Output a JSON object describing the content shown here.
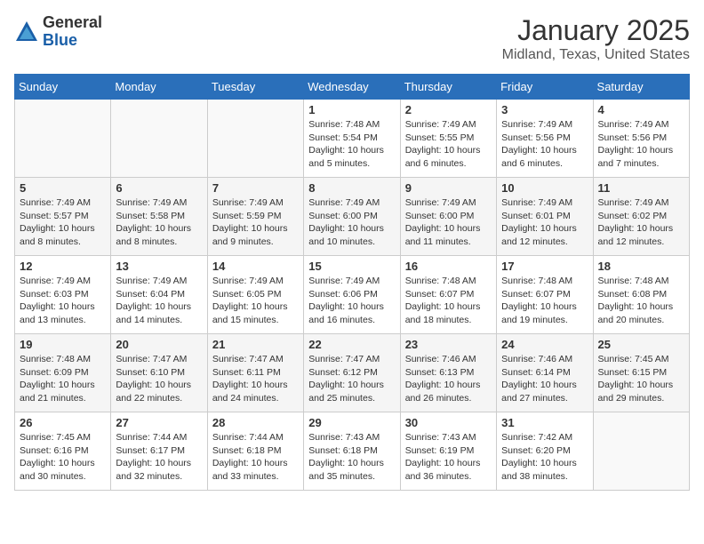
{
  "header": {
    "logo_general": "General",
    "logo_blue": "Blue",
    "title": "January 2025",
    "subtitle": "Midland, Texas, United States"
  },
  "weekdays": [
    "Sunday",
    "Monday",
    "Tuesday",
    "Wednesday",
    "Thursday",
    "Friday",
    "Saturday"
  ],
  "weeks": [
    [
      {
        "day": "",
        "sunrise": "",
        "sunset": "",
        "daylight": ""
      },
      {
        "day": "",
        "sunrise": "",
        "sunset": "",
        "daylight": ""
      },
      {
        "day": "",
        "sunrise": "",
        "sunset": "",
        "daylight": ""
      },
      {
        "day": "1",
        "sunrise": "Sunrise: 7:48 AM",
        "sunset": "Sunset: 5:54 PM",
        "daylight": "Daylight: 10 hours and 5 minutes."
      },
      {
        "day": "2",
        "sunrise": "Sunrise: 7:49 AM",
        "sunset": "Sunset: 5:55 PM",
        "daylight": "Daylight: 10 hours and 6 minutes."
      },
      {
        "day": "3",
        "sunrise": "Sunrise: 7:49 AM",
        "sunset": "Sunset: 5:56 PM",
        "daylight": "Daylight: 10 hours and 6 minutes."
      },
      {
        "day": "4",
        "sunrise": "Sunrise: 7:49 AM",
        "sunset": "Sunset: 5:56 PM",
        "daylight": "Daylight: 10 hours and 7 minutes."
      }
    ],
    [
      {
        "day": "5",
        "sunrise": "Sunrise: 7:49 AM",
        "sunset": "Sunset: 5:57 PM",
        "daylight": "Daylight: 10 hours and 8 minutes."
      },
      {
        "day": "6",
        "sunrise": "Sunrise: 7:49 AM",
        "sunset": "Sunset: 5:58 PM",
        "daylight": "Daylight: 10 hours and 8 minutes."
      },
      {
        "day": "7",
        "sunrise": "Sunrise: 7:49 AM",
        "sunset": "Sunset: 5:59 PM",
        "daylight": "Daylight: 10 hours and 9 minutes."
      },
      {
        "day": "8",
        "sunrise": "Sunrise: 7:49 AM",
        "sunset": "Sunset: 6:00 PM",
        "daylight": "Daylight: 10 hours and 10 minutes."
      },
      {
        "day": "9",
        "sunrise": "Sunrise: 7:49 AM",
        "sunset": "Sunset: 6:00 PM",
        "daylight": "Daylight: 10 hours and 11 minutes."
      },
      {
        "day": "10",
        "sunrise": "Sunrise: 7:49 AM",
        "sunset": "Sunset: 6:01 PM",
        "daylight": "Daylight: 10 hours and 12 minutes."
      },
      {
        "day": "11",
        "sunrise": "Sunrise: 7:49 AM",
        "sunset": "Sunset: 6:02 PM",
        "daylight": "Daylight: 10 hours and 12 minutes."
      }
    ],
    [
      {
        "day": "12",
        "sunrise": "Sunrise: 7:49 AM",
        "sunset": "Sunset: 6:03 PM",
        "daylight": "Daylight: 10 hours and 13 minutes."
      },
      {
        "day": "13",
        "sunrise": "Sunrise: 7:49 AM",
        "sunset": "Sunset: 6:04 PM",
        "daylight": "Daylight: 10 hours and 14 minutes."
      },
      {
        "day": "14",
        "sunrise": "Sunrise: 7:49 AM",
        "sunset": "Sunset: 6:05 PM",
        "daylight": "Daylight: 10 hours and 15 minutes."
      },
      {
        "day": "15",
        "sunrise": "Sunrise: 7:49 AM",
        "sunset": "Sunset: 6:06 PM",
        "daylight": "Daylight: 10 hours and 16 minutes."
      },
      {
        "day": "16",
        "sunrise": "Sunrise: 7:48 AM",
        "sunset": "Sunset: 6:07 PM",
        "daylight": "Daylight: 10 hours and 18 minutes."
      },
      {
        "day": "17",
        "sunrise": "Sunrise: 7:48 AM",
        "sunset": "Sunset: 6:07 PM",
        "daylight": "Daylight: 10 hours and 19 minutes."
      },
      {
        "day": "18",
        "sunrise": "Sunrise: 7:48 AM",
        "sunset": "Sunset: 6:08 PM",
        "daylight": "Daylight: 10 hours and 20 minutes."
      }
    ],
    [
      {
        "day": "19",
        "sunrise": "Sunrise: 7:48 AM",
        "sunset": "Sunset: 6:09 PM",
        "daylight": "Daylight: 10 hours and 21 minutes."
      },
      {
        "day": "20",
        "sunrise": "Sunrise: 7:47 AM",
        "sunset": "Sunset: 6:10 PM",
        "daylight": "Daylight: 10 hours and 22 minutes."
      },
      {
        "day": "21",
        "sunrise": "Sunrise: 7:47 AM",
        "sunset": "Sunset: 6:11 PM",
        "daylight": "Daylight: 10 hours and 24 minutes."
      },
      {
        "day": "22",
        "sunrise": "Sunrise: 7:47 AM",
        "sunset": "Sunset: 6:12 PM",
        "daylight": "Daylight: 10 hours and 25 minutes."
      },
      {
        "day": "23",
        "sunrise": "Sunrise: 7:46 AM",
        "sunset": "Sunset: 6:13 PM",
        "daylight": "Daylight: 10 hours and 26 minutes."
      },
      {
        "day": "24",
        "sunrise": "Sunrise: 7:46 AM",
        "sunset": "Sunset: 6:14 PM",
        "daylight": "Daylight: 10 hours and 27 minutes."
      },
      {
        "day": "25",
        "sunrise": "Sunrise: 7:45 AM",
        "sunset": "Sunset: 6:15 PM",
        "daylight": "Daylight: 10 hours and 29 minutes."
      }
    ],
    [
      {
        "day": "26",
        "sunrise": "Sunrise: 7:45 AM",
        "sunset": "Sunset: 6:16 PM",
        "daylight": "Daylight: 10 hours and 30 minutes."
      },
      {
        "day": "27",
        "sunrise": "Sunrise: 7:44 AM",
        "sunset": "Sunset: 6:17 PM",
        "daylight": "Daylight: 10 hours and 32 minutes."
      },
      {
        "day": "28",
        "sunrise": "Sunrise: 7:44 AM",
        "sunset": "Sunset: 6:18 PM",
        "daylight": "Daylight: 10 hours and 33 minutes."
      },
      {
        "day": "29",
        "sunrise": "Sunrise: 7:43 AM",
        "sunset": "Sunset: 6:18 PM",
        "daylight": "Daylight: 10 hours and 35 minutes."
      },
      {
        "day": "30",
        "sunrise": "Sunrise: 7:43 AM",
        "sunset": "Sunset: 6:19 PM",
        "daylight": "Daylight: 10 hours and 36 minutes."
      },
      {
        "day": "31",
        "sunrise": "Sunrise: 7:42 AM",
        "sunset": "Sunset: 6:20 PM",
        "daylight": "Daylight: 10 hours and 38 minutes."
      },
      {
        "day": "",
        "sunrise": "",
        "sunset": "",
        "daylight": ""
      }
    ]
  ]
}
